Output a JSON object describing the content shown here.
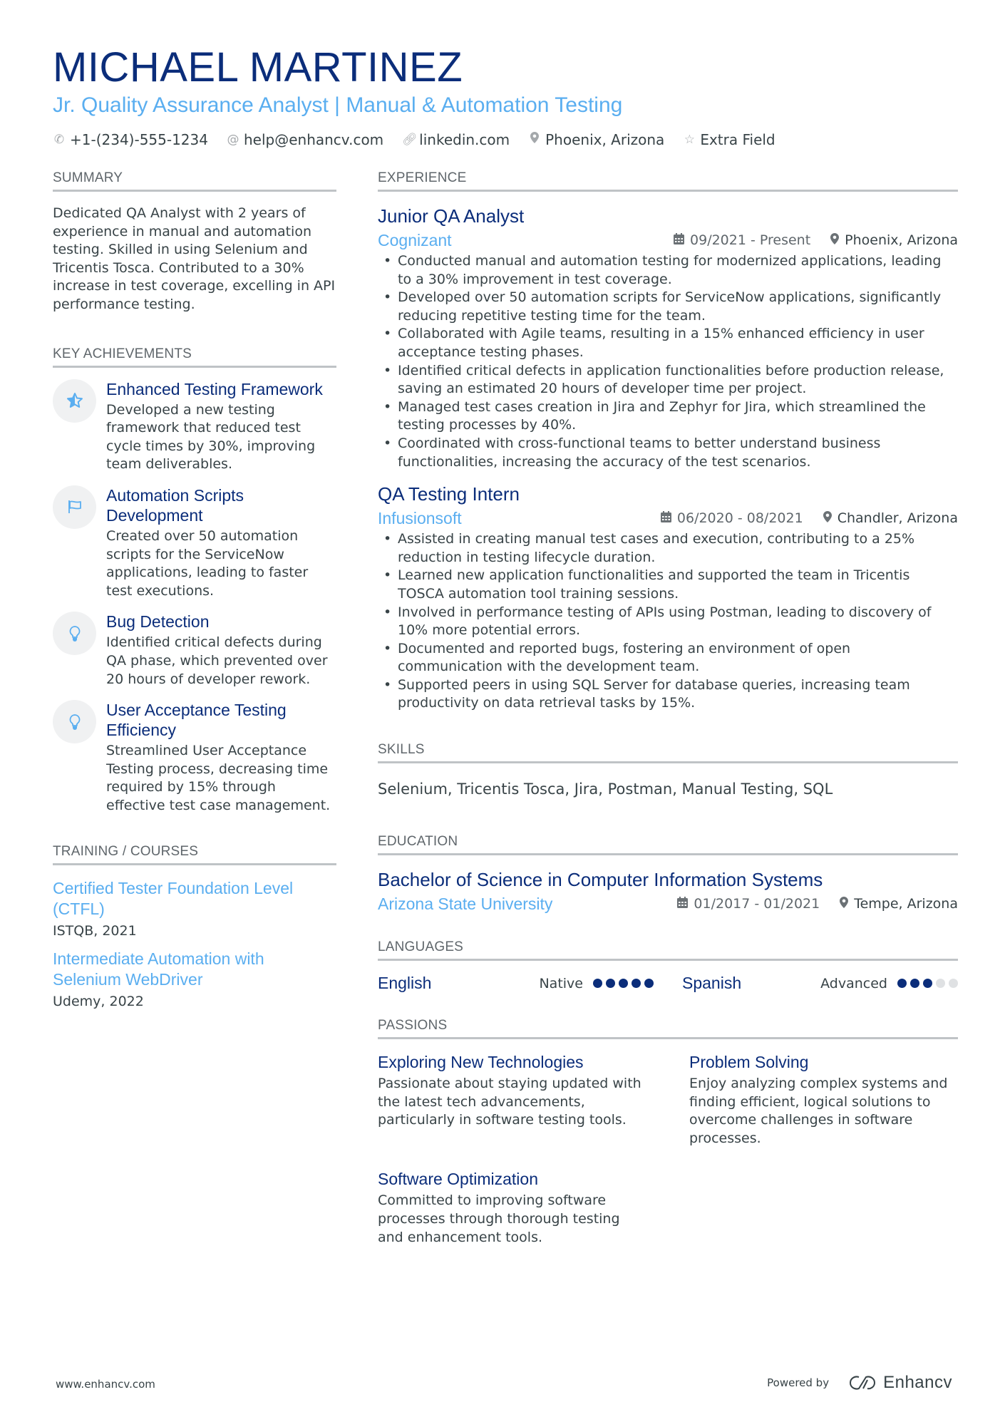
{
  "header": {
    "name": "MICHAEL MARTINEZ",
    "title": "Jr. Quality Assurance Analyst | Manual & Automation Testing",
    "contacts": [
      {
        "icon": "phone-icon",
        "text": "+1-(234)-555-1234"
      },
      {
        "icon": "at-icon",
        "text": "help@enhancv.com"
      },
      {
        "icon": "link-icon",
        "text": "linkedin.com"
      },
      {
        "icon": "location-icon",
        "text": "Phoenix, Arizona"
      },
      {
        "icon": "star-icon",
        "text": "Extra Field"
      }
    ]
  },
  "summary": {
    "heading": "SUMMARY",
    "text": "Dedicated QA Analyst with 2 years of experience in manual and automation testing. Skilled in using Selenium and Tricentis Tosca. Contributed to a 30% increase in test coverage, excelling in API performance testing."
  },
  "achievements": {
    "heading": "KEY ACHIEVEMENTS",
    "items": [
      {
        "icon": "star-icon",
        "title": "Enhanced Testing Framework",
        "desc": "Developed a new testing framework that reduced test cycle times by 30%, improving team deliverables."
      },
      {
        "icon": "flag-icon",
        "title": "Automation Scripts Development",
        "desc": "Created over 50 automation scripts for the ServiceNow applications, leading to faster test executions."
      },
      {
        "icon": "lightbulb-icon",
        "title": "Bug Detection",
        "desc": "Identified critical defects during QA phase, which prevented over 20 hours of developer rework."
      },
      {
        "icon": "lightbulb-icon",
        "title": "User Acceptance Testing Efficiency",
        "desc": "Streamlined User Acceptance Testing process, decreasing time required by 15% through effective test case management."
      }
    ]
  },
  "training": {
    "heading": "TRAINING / COURSES",
    "items": [
      {
        "title": "Certified Tester Foundation Level (CTFL)",
        "sub": "ISTQB, 2021"
      },
      {
        "title": "Intermediate Automation with Selenium WebDriver",
        "sub": "Udemy, 2022"
      }
    ]
  },
  "experience": {
    "heading": "EXPERIENCE",
    "jobs": [
      {
        "title": "Junior QA Analyst",
        "company": "Cognizant",
        "dates": "09/2021 - Present",
        "location": "Phoenix, Arizona",
        "bullets": [
          "Conducted manual and automation testing for modernized applications, leading to a 30% improvement in test coverage.",
          "Developed over 50 automation scripts for ServiceNow applications, significantly reducing repetitive testing time for the team.",
          "Collaborated with Agile teams, resulting in a 15% enhanced efficiency in user acceptance testing phases.",
          "Identified critical defects in application functionalities before production release, saving an estimated 20 hours of developer time per project.",
          "Managed test cases creation in Jira and Zephyr for Jira, which streamlined the testing processes by 40%.",
          "Coordinated with cross-functional teams to better understand business functionalities, increasing the accuracy of the test scenarios."
        ]
      },
      {
        "title": "QA Testing Intern",
        "company": "Infusionsoft",
        "dates": "06/2020 - 08/2021",
        "location": "Chandler, Arizona",
        "bullets": [
          "Assisted in creating manual test cases and execution, contributing to a 25% reduction in testing lifecycle duration.",
          "Learned new application functionalities and supported the team in Tricentis TOSCA automation tool training sessions.",
          "Involved in performance testing of APIs using Postman, leading to discovery of 10% more potential errors.",
          "Documented and reported bugs, fostering an environment of open communication with the development team.",
          "Supported peers in using SQL Server for database queries, increasing team productivity on data retrieval tasks by 15%."
        ]
      }
    ]
  },
  "skills": {
    "heading": "SKILLS",
    "text": "Selenium, Tricentis Tosca, Jira, Postman, Manual Testing, SQL"
  },
  "education": {
    "heading": "EDUCATION",
    "degree": "Bachelor of Science in Computer Information Systems",
    "school": "Arizona State University",
    "dates": "01/2017 - 01/2021",
    "location": "Tempe, Arizona"
  },
  "languages": {
    "heading": "LANGUAGES",
    "items": [
      {
        "name": "English",
        "level": "Native",
        "rating": 5,
        "max": 5
      },
      {
        "name": "Spanish",
        "level": "Advanced",
        "rating": 3,
        "max": 5
      }
    ]
  },
  "passions": {
    "heading": "PASSIONS",
    "items": [
      {
        "title": "Exploring New Technologies",
        "desc": "Passionate about staying updated with the latest tech advancements, particularly in software testing tools."
      },
      {
        "title": "Problem Solving",
        "desc": "Enjoy analyzing complex systems and finding efficient, logical solutions to overcome challenges in software processes."
      },
      {
        "title": "Software Optimization",
        "desc": "Committed to improving software processes through thorough testing and enhancement tools."
      }
    ]
  },
  "footer": {
    "website": "www.enhancv.com",
    "powered_by": "Powered by",
    "brand": "Enhancv"
  },
  "colors": {
    "primary": "#0b2d7a",
    "accent": "#5aaef0",
    "text": "#384347",
    "heading": "#5f666b",
    "rule": "#bfc3c6"
  }
}
